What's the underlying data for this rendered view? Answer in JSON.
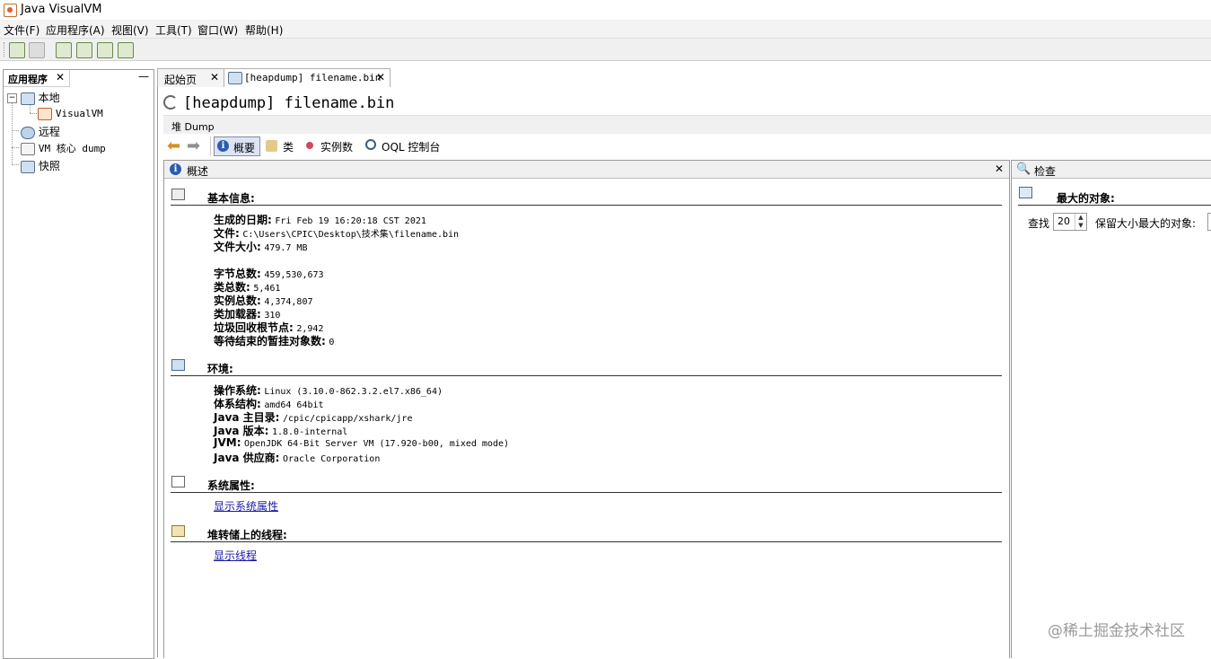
{
  "window": {
    "title": "Java VisualVM"
  },
  "menu": [
    "文件(F)",
    "应用程序(A)",
    "视图(V)",
    "工具(T)",
    "窗口(W)",
    "帮助(H)"
  ],
  "toolbar_icons": [
    "load-snapshot-icon",
    "save-icon",
    "add-jmx-connection-icon",
    "add-remote-host-icon",
    "add-vm-coredump-icon",
    "add-snapshot-icon"
  ],
  "left_panel": {
    "tab_label": "应用程序",
    "close": "✕",
    "minimize": "—",
    "tree": {
      "local": "本地",
      "visualvm": "VisualVM",
      "remote": "远程",
      "coredump": "VM 核心 dump",
      "snapshots": "快照"
    }
  },
  "tabs": [
    {
      "label": "起始页",
      "close": "✕"
    },
    {
      "label": "[heapdump] filename.bin",
      "close": "✕"
    }
  ],
  "document": {
    "title": "[heapdump] filename.bin",
    "heap_label": "堆 Dump",
    "nav": {
      "summary": "概要",
      "classes": "类",
      "instances": "实例数",
      "oql": "OQL 控制台"
    }
  },
  "overview": {
    "header": "概述",
    "close": "✕",
    "basic": {
      "title": "基本信息:",
      "rows": [
        {
          "k": "生成的日期:",
          "v": "Fri Feb 19 16:20:18 CST 2021"
        },
        {
          "k": "文件:",
          "v": "C:\\Users\\CPIC\\Desktop\\技术集\\filename.bin"
        },
        {
          "k": "文件大小:",
          "v": "479.7 MB"
        },
        {
          "k": "字节总数:",
          "v": "459,530,673"
        },
        {
          "k": "类总数:",
          "v": "5,461"
        },
        {
          "k": "实例总数:",
          "v": "4,374,807"
        },
        {
          "k": "类加载器:",
          "v": "310"
        },
        {
          "k": "垃圾回收根节点:",
          "v": "2,942"
        },
        {
          "k": "等待结束的暂挂对象数:",
          "v": "0"
        }
      ]
    },
    "env": {
      "title": "环境:",
      "rows": [
        {
          "k": "操作系统:",
          "v": "Linux (3.10.0-862.3.2.el7.x86_64)"
        },
        {
          "k": "体系结构:",
          "v": "amd64 64bit"
        },
        {
          "k": "Java 主目录:",
          "v": "/cpic/cpicapp/xshark/jre"
        },
        {
          "k": "Java 版本:",
          "v": "1.8.0-internal"
        },
        {
          "k": "JVM:",
          "v": "OpenJDK 64-Bit Server VM (17.920-b00, mixed mode)"
        },
        {
          "k": "Java 供应商:",
          "v": "Oracle Corporation"
        }
      ]
    },
    "sysprops": {
      "title": "系统属性:",
      "link": "显示系统属性"
    },
    "threads": {
      "title": "堆转储上的线程:",
      "link": "显示线程"
    }
  },
  "inspect": {
    "header": "检查",
    "largest_title": "最大的对象:",
    "find_label": "查找",
    "find_value": "20",
    "retained_label": "保留大小最大的对象:"
  },
  "watermark": "@稀土掘金技术社区"
}
